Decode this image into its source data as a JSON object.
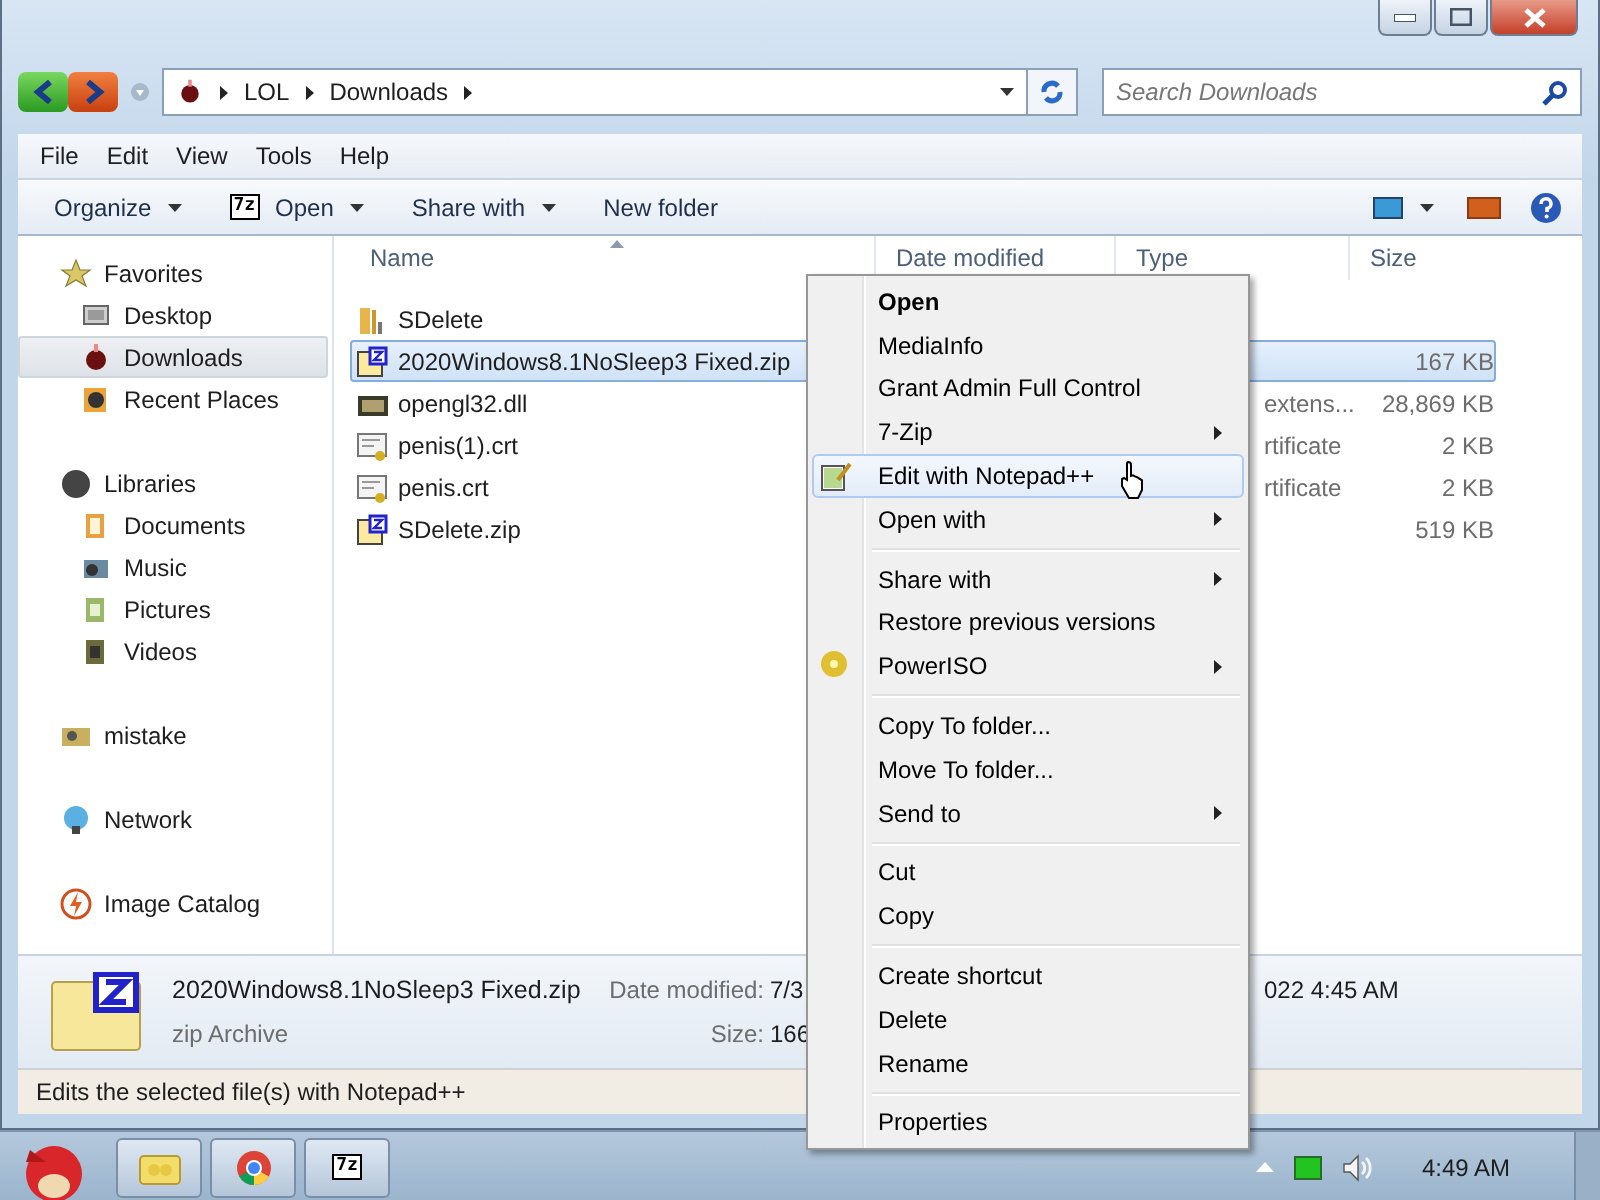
{
  "window": {
    "search": {
      "placeholder": "Search Downloads"
    }
  },
  "address": {
    "crumbs": [
      "LOL",
      "Downloads"
    ]
  },
  "menubar": [
    "File",
    "Edit",
    "View",
    "Tools",
    "Help"
  ],
  "toolbar": {
    "buttons": [
      {
        "label": "Organize",
        "kind": "dropdown"
      },
      {
        "label": "Open",
        "kind": "open",
        "icon_text": "7z"
      },
      {
        "label": "Share with",
        "kind": "dropdown"
      },
      {
        "label": "New folder",
        "kind": "plain"
      }
    ]
  },
  "sidebar": {
    "groups": [
      {
        "label": "Favorites",
        "kind": "star",
        "selected": false,
        "children": [
          {
            "label": "Desktop",
            "kind": "desktop",
            "selected": false
          },
          {
            "label": "Downloads",
            "kind": "bug",
            "selected": true
          },
          {
            "label": "Recent Places",
            "kind": "recent",
            "selected": false
          }
        ]
      },
      {
        "label": "Libraries",
        "kind": "library",
        "selected": false,
        "children": [
          {
            "label": "Documents",
            "kind": "docs",
            "selected": false
          },
          {
            "label": "Music",
            "kind": "music",
            "selected": false
          },
          {
            "label": "Pictures",
            "kind": "pictures",
            "selected": false
          },
          {
            "label": "Videos",
            "kind": "videos",
            "selected": false
          }
        ]
      },
      {
        "label": "mistake",
        "kind": "user",
        "selected": false
      },
      {
        "label": "Network",
        "kind": "network",
        "selected": false
      },
      {
        "label": "Image Catalog",
        "kind": "catalog",
        "selected": false
      }
    ]
  },
  "files": {
    "columns": [
      "Name",
      "Date modified",
      "Type",
      "Size"
    ],
    "rows": [
      {
        "name": "SDelete",
        "kind": "folder",
        "selected": false
      },
      {
        "name": "2020Windows8.1NoSleep3 Fixed.zip",
        "kind": "zip",
        "size": "167 KB",
        "selected": true
      },
      {
        "name": "opengl32.dll",
        "kind": "dll",
        "type": "extens...",
        "size": "28,869 KB",
        "selected": false
      },
      {
        "name": "penis(1).crt",
        "kind": "cert",
        "type": "rtificate",
        "size": "2 KB",
        "selected": false
      },
      {
        "name": "penis.crt",
        "kind": "cert",
        "type": "rtificate",
        "size": "2 KB",
        "selected": false
      },
      {
        "name": "SDelete.zip",
        "kind": "zip",
        "size": "519 KB",
        "selected": false
      }
    ]
  },
  "details": {
    "name": "2020Windows8.1NoSleep3 Fixed.zip",
    "type": "zip Archive",
    "date_label": "Date modified:",
    "date_value": "7/3",
    "date_value_tail": "022 4:45 AM",
    "size_label": "Size:",
    "size_value": "166"
  },
  "status_bar": {
    "text": "Edits the selected file(s) with Notepad++"
  },
  "context_menu": {
    "items": [
      {
        "kind": "item",
        "label": "Open",
        "bold": true,
        "submenu": false,
        "selected": false
      },
      {
        "kind": "item",
        "label": "MediaInfo",
        "bold": false,
        "submenu": false,
        "selected": false
      },
      {
        "kind": "item",
        "label": "Grant Admin Full Control",
        "bold": false,
        "submenu": false,
        "selected": false
      },
      {
        "kind": "item",
        "label": "7-Zip",
        "bold": false,
        "submenu": true,
        "selected": false
      },
      {
        "kind": "notepad",
        "label": "Edit with Notepad++",
        "bold": false,
        "submenu": false,
        "selected": true
      },
      {
        "kind": "item",
        "label": "Open with",
        "bold": false,
        "submenu": true,
        "selected": false
      },
      {
        "kind": "separator"
      },
      {
        "kind": "item",
        "label": "Share with",
        "bold": false,
        "submenu": true,
        "selected": false
      },
      {
        "kind": "item",
        "label": "Restore previous versions",
        "bold": false,
        "submenu": false,
        "selected": false
      },
      {
        "kind": "disc",
        "label": "PowerISO",
        "bold": false,
        "submenu": true,
        "selected": false
      },
      {
        "kind": "separator"
      },
      {
        "kind": "item",
        "label": "Copy To folder...",
        "bold": false,
        "submenu": false,
        "selected": false
      },
      {
        "kind": "item",
        "label": "Move To folder...",
        "bold": false,
        "submenu": false,
        "selected": false
      },
      {
        "kind": "item",
        "label": "Send to",
        "bold": false,
        "submenu": true,
        "selected": false
      },
      {
        "kind": "separator"
      },
      {
        "kind": "item",
        "label": "Cut",
        "bold": false,
        "submenu": false,
        "selected": false
      },
      {
        "kind": "item",
        "label": "Copy",
        "bold": false,
        "submenu": false,
        "selected": false
      },
      {
        "kind": "separator"
      },
      {
        "kind": "item",
        "label": "Create shortcut",
        "bold": false,
        "submenu": false,
        "selected": false
      },
      {
        "kind": "item",
        "label": "Delete",
        "bold": false,
        "submenu": false,
        "selected": false
      },
      {
        "kind": "item",
        "label": "Rename",
        "bold": false,
        "submenu": false,
        "selected": false
      },
      {
        "kind": "separator"
      },
      {
        "kind": "item",
        "label": "Properties",
        "bold": false,
        "submenu": false,
        "selected": false
      }
    ]
  },
  "taskbar": {
    "buttons": [
      {
        "kind": "explorer"
      },
      {
        "kind": "chrome"
      },
      {
        "kind": "sevenzip",
        "icon_text": "7z"
      }
    ],
    "clock": "4:49 AM"
  }
}
